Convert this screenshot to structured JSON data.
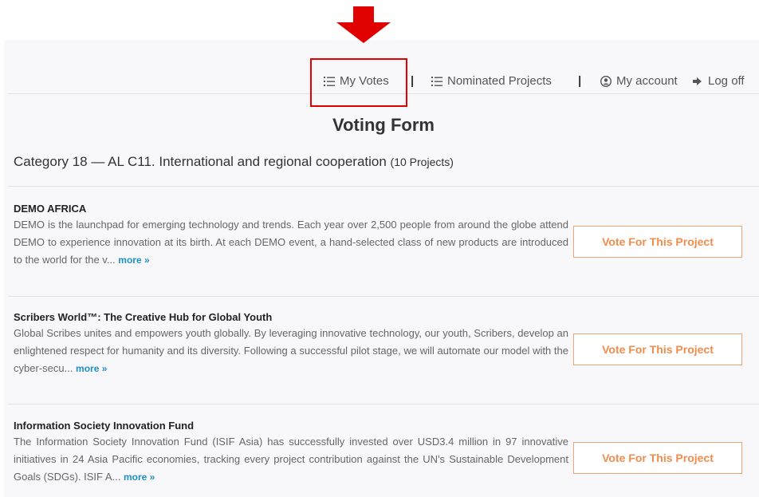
{
  "nav": {
    "my_votes": "My Votes",
    "separator": "|",
    "nominated_projects": "Nominated Projects",
    "my_account": "My account",
    "log_off": "Log off"
  },
  "page": {
    "title": "Voting Form",
    "category": "Category 18 — AL C11. International and regional cooperation",
    "category_count": "(10 Projects)"
  },
  "projects": [
    {
      "title": "DEMO AFRICA",
      "description": "DEMO is the launchpad for emerging technology and trends. Each year over 2,500 people from around the globe attend DEMO to experience innovation at its birth. At each DEMO event, a hand-selected class of new products are introduced to the world for the v...",
      "more": "more »",
      "vote_label": "Vote For This Project"
    },
    {
      "title": "Scribers World™: The Creative Hub for Global Youth",
      "description": "Global Scribes unites and empowers youth globally. By leveraging innovative technology, our youth, Scribers, develop an enlightened respect for humanity and its diversity. Following a successful pilot stage, we will automate our model with the cyber-secu...",
      "more": "more »",
      "vote_label": "Vote For This Project"
    },
    {
      "title": "Information Society Innovation Fund",
      "description": "The Information Society Innovation Fund (ISIF Asia) has successfully invested over USD3.4 million in 97 innovative initiatives in 24 Asia Pacific economies, tracking every project contribution against the UN's Sustainable Development Goals (SDGs). ISIF A...",
      "more": "more »",
      "vote_label": "Vote For This Project"
    }
  ],
  "colors": {
    "highlight": "#e00000",
    "accent": "#f08c4c",
    "link": "#1f8fc6"
  }
}
